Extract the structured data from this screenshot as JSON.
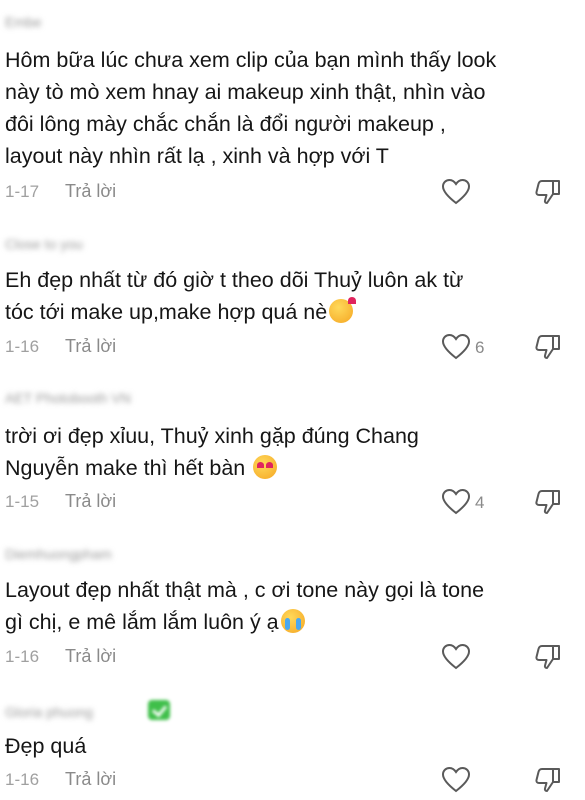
{
  "comments": [
    {
      "username": "Embe",
      "text": "Hôm bữa lúc chưa xem clip của bạn mình thấy look\nnày tò mò xem hnay ai makeup xinh thật, nhìn vào\nđôi lông mày chắc chắn là đổi người makeup ,\nlayout này nhìn rất lạ , xinh và hợp với T",
      "date": "1-17",
      "reply_label": "Trả lời",
      "like_count": ""
    },
    {
      "username": "Close to you",
      "text": "Eh đẹp nhất từ đó giờ t theo dõi Thuỷ luôn ak từ\ntóc tới make up,make hợp quá nè",
      "emoji": "smiling-face-with-hearts",
      "date": "1-16",
      "reply_label": "Trả lời",
      "like_count": "6"
    },
    {
      "username": "AET Photobooth VN",
      "text": "trời ơi đẹp xỉuu, Thuỷ xinh gặp đúng Chang\nNguyễn make thì hết bàn ",
      "emoji": "heart-eyes",
      "date": "1-15",
      "reply_label": "Trả lời",
      "like_count": "4"
    },
    {
      "username": "Diemhuongpham",
      "text": "Layout đẹp nhất thật mà , c ơi tone này gọi là tone\ngì chị, e mê lắm lắm luôn ý ạ",
      "emoji": "loudly-crying",
      "date": "1-16",
      "reply_label": "Trả lời",
      "like_count": ""
    },
    {
      "username": "Gloria phuong",
      "text": "Đẹp quá",
      "badge": "verified-icon",
      "date": "1-16",
      "reply_label": "Trả lời",
      "like_count": ""
    }
  ],
  "icons": {
    "like": "heart-outline-icon",
    "dislike": "thumbs-down-outline-icon"
  }
}
